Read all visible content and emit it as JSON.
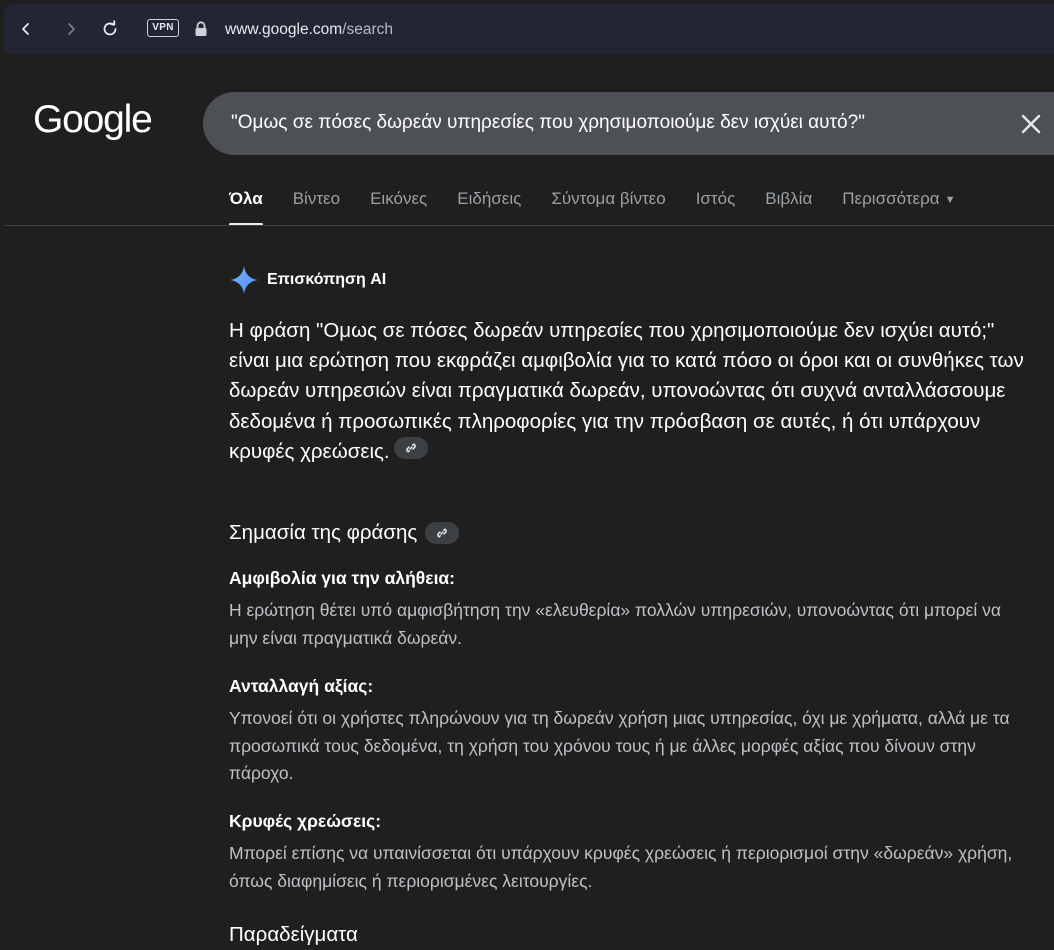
{
  "browser": {
    "vpn_label": "VPN",
    "url_host": "www.google.com",
    "url_path": "/search"
  },
  "google": {
    "logo_text": "Google",
    "query": "\"Ομως σε πόσες δωρεάν υπηρεσίες που χρησιμοποιούμε δεν ισχύει αυτό?\""
  },
  "tabs": [
    {
      "label": "Όλα",
      "active": true
    },
    {
      "label": "Βίντεο"
    },
    {
      "label": "Εικόνες"
    },
    {
      "label": "Ειδήσεις"
    },
    {
      "label": "Σύντομα βίντεο"
    },
    {
      "label": "Ιστός"
    },
    {
      "label": "Βιβλία"
    },
    {
      "label": "Περισσότερα"
    }
  ],
  "ai_overview": {
    "title": "Επισκόπηση AI",
    "summary": "Η φράση \"Ομως σε πόσες δωρεάν υπηρεσίες που χρησιμοποιούμε δεν ισχύει αυτό;\" είναι μια ερώτηση που εκφράζει αμφιβολία για το κατά πόσο οι όροι και οι συνθήκες των δωρεάν υπηρεσιών είναι πραγματικά δωρεάν, υπονοώντας ότι συχνά ανταλλάσσουμε δεδομένα ή προσωπικές πληροφορίες για την πρόσβαση σε αυτές, ή ότι υπάρχουν κρυφές χρεώσεις.",
    "section_heading": "Σημασία της φράσης",
    "points": [
      {
        "title": "Αμφιβολία για την αλήθεια:",
        "text": "Η ερώτηση θέτει υπό αμφισβήτηση την «ελευθερία» πολλών υπηρεσιών, υπονοώντας ότι μπορεί να μην είναι πραγματικά δωρεάν."
      },
      {
        "title": "Ανταλλαγή αξίας:",
        "text": "Υπονοεί ότι οι χρήστες πληρώνουν για τη δωρεάν χρήση μιας υπηρεσίας, όχι με χρήματα, αλλά με τα προσωπικά τους δεδομένα, τη χρήση του χρόνου τους ή με άλλες μορφές αξίας που δίνουν στην πάροχο."
      },
      {
        "title": "Κρυφές χρεώσεις:",
        "text": "Μπορεί επίσης να υπαινίσσεται ότι υπάρχουν κρυφές χρεώσεις ή περιορισμοί στην «δωρεάν» χρήση, όπως διαφημίσεις ή περιορισμένες λειτουργίες."
      }
    ],
    "examples_heading": "Παραδείγματα"
  }
}
